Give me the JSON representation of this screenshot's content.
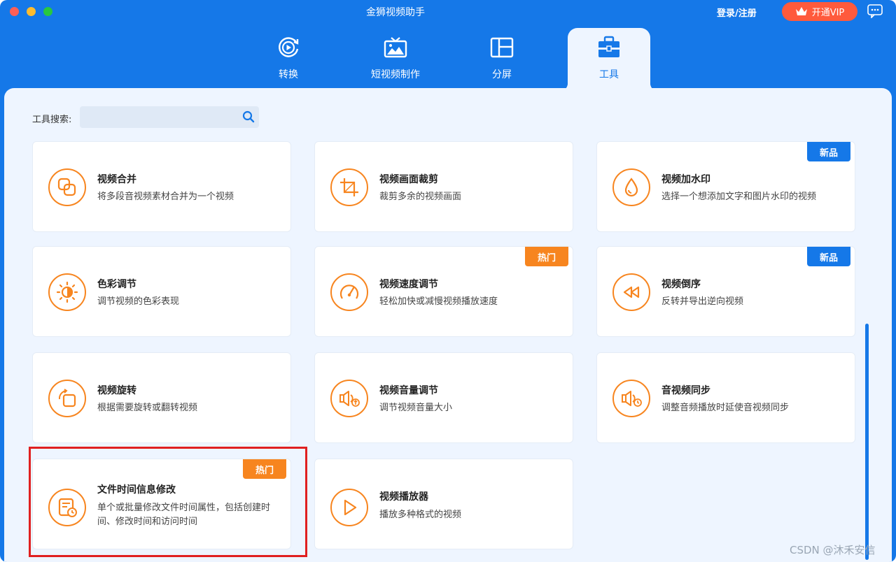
{
  "app": {
    "title": "金狮视频助手"
  },
  "header": {
    "login_label": "登录/注册",
    "vip_label": "开通VIP"
  },
  "tabs": [
    {
      "label": "转换",
      "icon": "convert-icon"
    },
    {
      "label": "短视频制作",
      "icon": "tv-image-icon"
    },
    {
      "label": "分屏",
      "icon": "split-screen-icon"
    },
    {
      "label": "工具",
      "icon": "toolbox-icon",
      "active": true
    }
  ],
  "search": {
    "label": "工具搜索:",
    "value": "",
    "placeholder": ""
  },
  "tools": [
    {
      "title": "视频合并",
      "desc": "将多段音视频素材合并为一个视频",
      "icon": "merge-icon",
      "badge": ""
    },
    {
      "title": "视频画面裁剪",
      "desc": "裁剪多余的视频画面",
      "icon": "crop-icon",
      "badge": ""
    },
    {
      "title": "视频加水印",
      "desc": "选择一个想添加文字和图片水印的视频",
      "icon": "droplet-icon",
      "badge": "新品"
    },
    {
      "title": "色彩调节",
      "desc": "调节视频的色彩表现",
      "icon": "sun-icon",
      "badge": ""
    },
    {
      "title": "视频速度调节",
      "desc": "轻松加快或减慢视频播放速度",
      "icon": "speedometer-icon",
      "badge": "热门"
    },
    {
      "title": "视频倒序",
      "desc": "反转并导出逆向视频",
      "icon": "rewind-icon",
      "badge": "新品"
    },
    {
      "title": "视频旋转",
      "desc": "根据需要旋转或翻转视频",
      "icon": "rotate-icon",
      "badge": ""
    },
    {
      "title": "视频音量调节",
      "desc": "调节视频音量大小",
      "icon": "volume-up-icon",
      "badge": ""
    },
    {
      "title": "音视频同步",
      "desc": "调整音频播放时延使音视频同步",
      "icon": "volume-clock-icon",
      "badge": ""
    },
    {
      "title": "文件时间信息修改",
      "desc": "单个或批量修改文件时间属性，包括创建时间、修改时间和访问时间",
      "icon": "file-clock-icon",
      "badge": "热门"
    },
    {
      "title": "视频播放器",
      "desc": "播放多种格式的视频",
      "icon": "play-icon",
      "badge": ""
    }
  ],
  "watermark": "CSDN @沐禾安信",
  "colors": {
    "primary": "#1578e8",
    "accent": "#f7851f",
    "vip": "#ff5a3c",
    "highlight": "#e02020"
  }
}
